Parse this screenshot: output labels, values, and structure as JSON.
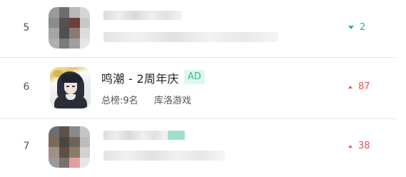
{
  "rows": [
    {
      "rank": "5",
      "blurred": true,
      "change": {
        "direction": "down",
        "value": "2",
        "color": "#22b58a"
      }
    },
    {
      "rank": "6",
      "blurred": false,
      "app": {
        "title": "鸣潮 - 2周年庆",
        "badge": "AD",
        "chart_rank": "总榜:9名",
        "publisher": "库洛游戏",
        "icon": "wuthering-waves-icon"
      },
      "change": {
        "direction": "up",
        "value": "87",
        "color": "#e8564e"
      }
    },
    {
      "rank": "7",
      "blurred": true,
      "change": {
        "direction": "up",
        "value": "38",
        "color": "#e8564e"
      }
    }
  ],
  "colors": {
    "down": "#22b58a",
    "up": "#e8564e",
    "badge_bg": "#dff6ee",
    "badge_text": "#2fbf8c",
    "divider": "#e6e6e6"
  }
}
